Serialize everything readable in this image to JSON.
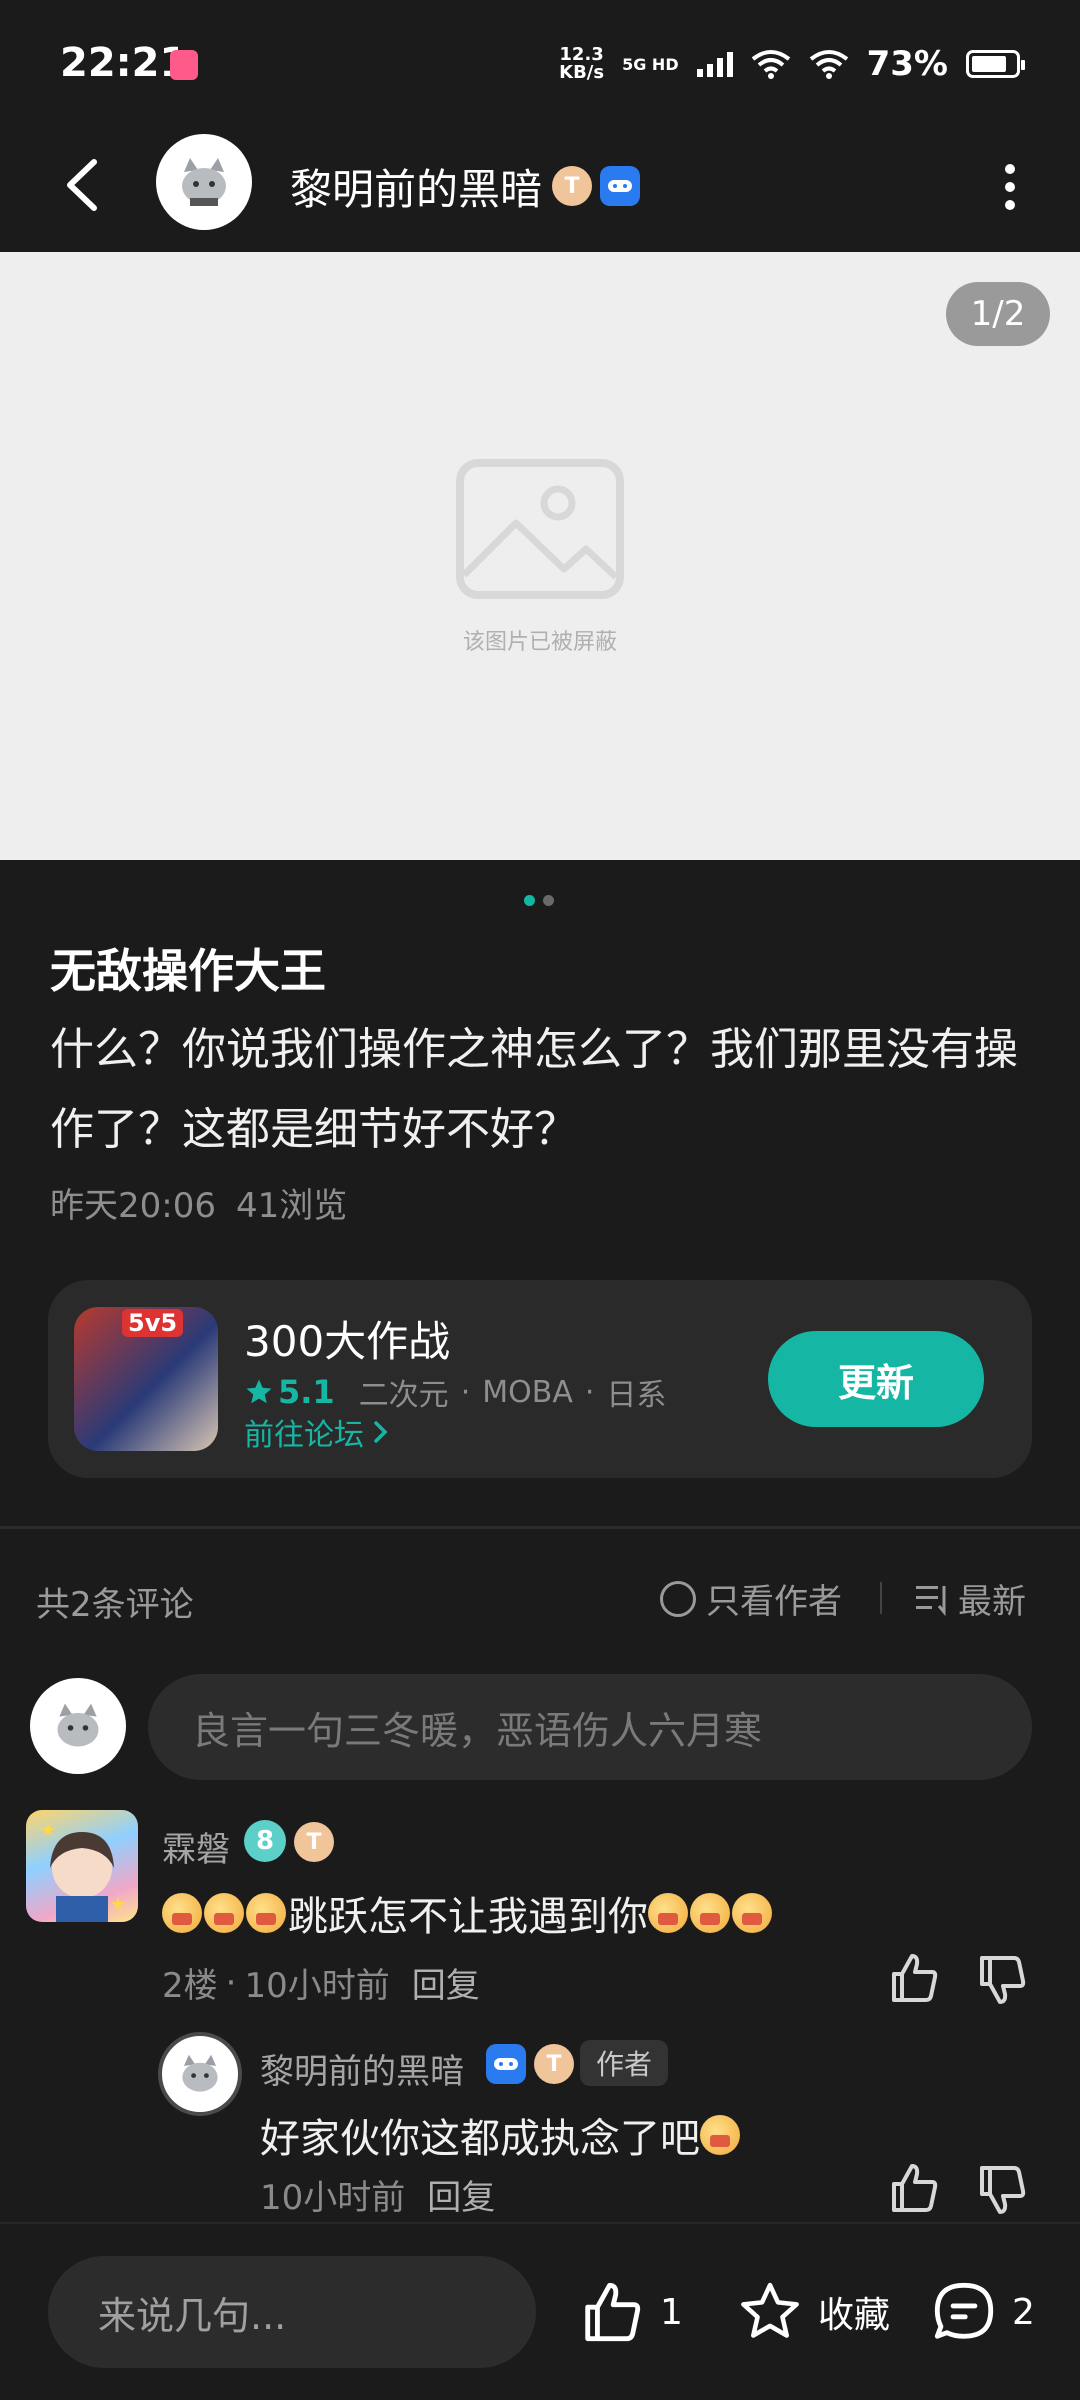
{
  "status": {
    "time": "22:21",
    "net_speed_value": "12.3",
    "net_speed_unit": "KB/s",
    "signal_label": "5G HD",
    "battery": "73%"
  },
  "header": {
    "author": "黎明前的黑暗",
    "badge_t": "T"
  },
  "image": {
    "page_indicator": "1/2",
    "blocked_text": "该图片已被屏蔽"
  },
  "post": {
    "title": "无敌操作大王",
    "body": "什么？你说我们操作之神怎么了？我们那里没有操作了？这都是细节好不好？",
    "time": "昨天20:06",
    "views": "41浏览"
  },
  "game": {
    "icon_tag": "5v5",
    "name": "300大作战",
    "rating": "5.1",
    "tags": [
      "二次元",
      "MOBA",
      "日系"
    ],
    "forum_link": "前往论坛",
    "update_label": "更新"
  },
  "comments_header": {
    "count": "共2条评论",
    "only_author": "只看作者",
    "sort": "最新"
  },
  "comment_input": {
    "placeholder": "良言一句三冬暖，恶语伤人六月寒"
  },
  "comments": [
    {
      "user": "霖磐",
      "level": "8",
      "badge": "T",
      "text": "跳跃怎不让我遇到你",
      "floor": "2楼",
      "time": "10小时前",
      "reply_label": "回复"
    }
  ],
  "reply": {
    "user": "黎明前的黑暗",
    "author_tag": "作者",
    "text": "好家伙你这都成执念了吧",
    "time": "10小时前",
    "reply_label": "回复"
  },
  "bottom_bar": {
    "input_placeholder": "来说几句...",
    "like_count": "1",
    "favorite_label": "收藏",
    "comment_count": "2"
  },
  "colors": {
    "accent": "#16b6a5",
    "background": "#1b1b1c",
    "card": "#2a2a2b"
  }
}
